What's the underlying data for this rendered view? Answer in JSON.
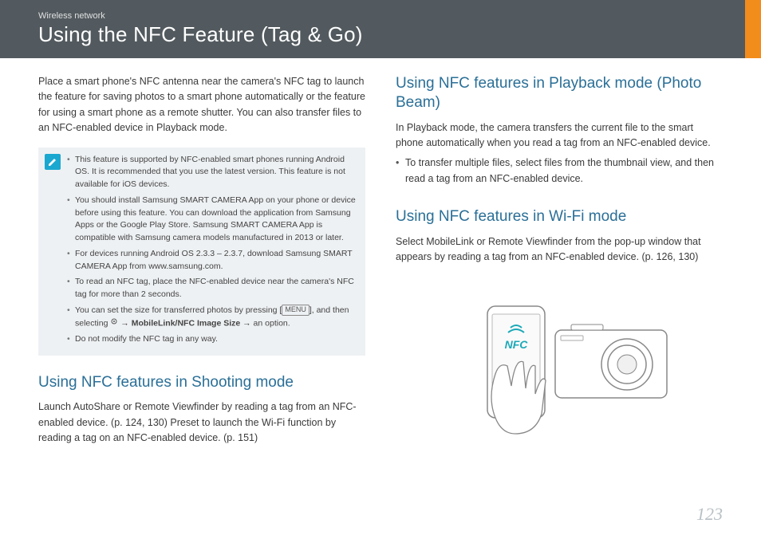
{
  "header": {
    "breadcrumb": "Wireless network",
    "title": "Using the NFC Feature (Tag & Go)"
  },
  "left": {
    "intro": "Place a smart phone's NFC antenna near the camera's NFC tag to launch the feature for saving photos to a smart phone automatically or the feature for using a smart phone as a remote shutter. You can also transfer files to an NFC-enabled device in Playback mode.",
    "notes": {
      "n1": "This feature is supported by NFC-enabled smart phones running Android OS. It is recommended that you use the latest version. This feature is not available for iOS devices.",
      "n2": "You should install Samsung SMART CAMERA App on your phone or device before using this feature. You can download the application from Samsung Apps or the Google Play Store. Samsung SMART CAMERA App is compatible with Samsung camera models manufactured in 2013 or later.",
      "n3": "For devices running Android OS 2.3.3 – 2.3.7, download Samsung SMART CAMERA App from www.samsung.com.",
      "n4": "To read an NFC tag, place the NFC-enabled device near the camera's NFC tag for more than 2 seconds.",
      "n5_pre": "You can set the size for transferred photos by pressing [",
      "n5_menu": "MENU",
      "n5_mid": "], and then selecting ",
      "n5_bold": "→ MobileLink/NFC Image Size →",
      "n5_post": " an option.",
      "n6": "Do not modify the NFC tag in any way."
    },
    "section1": {
      "title": "Using NFC features in Shooting mode",
      "body": "Launch AutoShare or Remote Viewfinder by reading a tag from an NFC-enabled device. (p. 124, 130) Preset to launch the Wi-Fi function by reading a tag on an NFC-enabled device. (p. 151)"
    }
  },
  "right": {
    "section1": {
      "title": "Using NFC features in Playback mode (Photo Beam)",
      "body": "In Playback mode, the camera transfers the current file to the smart phone automatically when you read a tag from an NFC-enabled device.",
      "bullet": "To transfer multiple files, select files from the thumbnail view, and then read a tag from an NFC-enabled device."
    },
    "section2": {
      "title": "Using NFC features in Wi-Fi mode",
      "body": "Select MobileLink or Remote Viewfinder from the pop-up window that appears by reading a tag from an NFC-enabled device. (p. 126, 130)"
    },
    "nfc_label": "NFC"
  },
  "page_number": "123"
}
